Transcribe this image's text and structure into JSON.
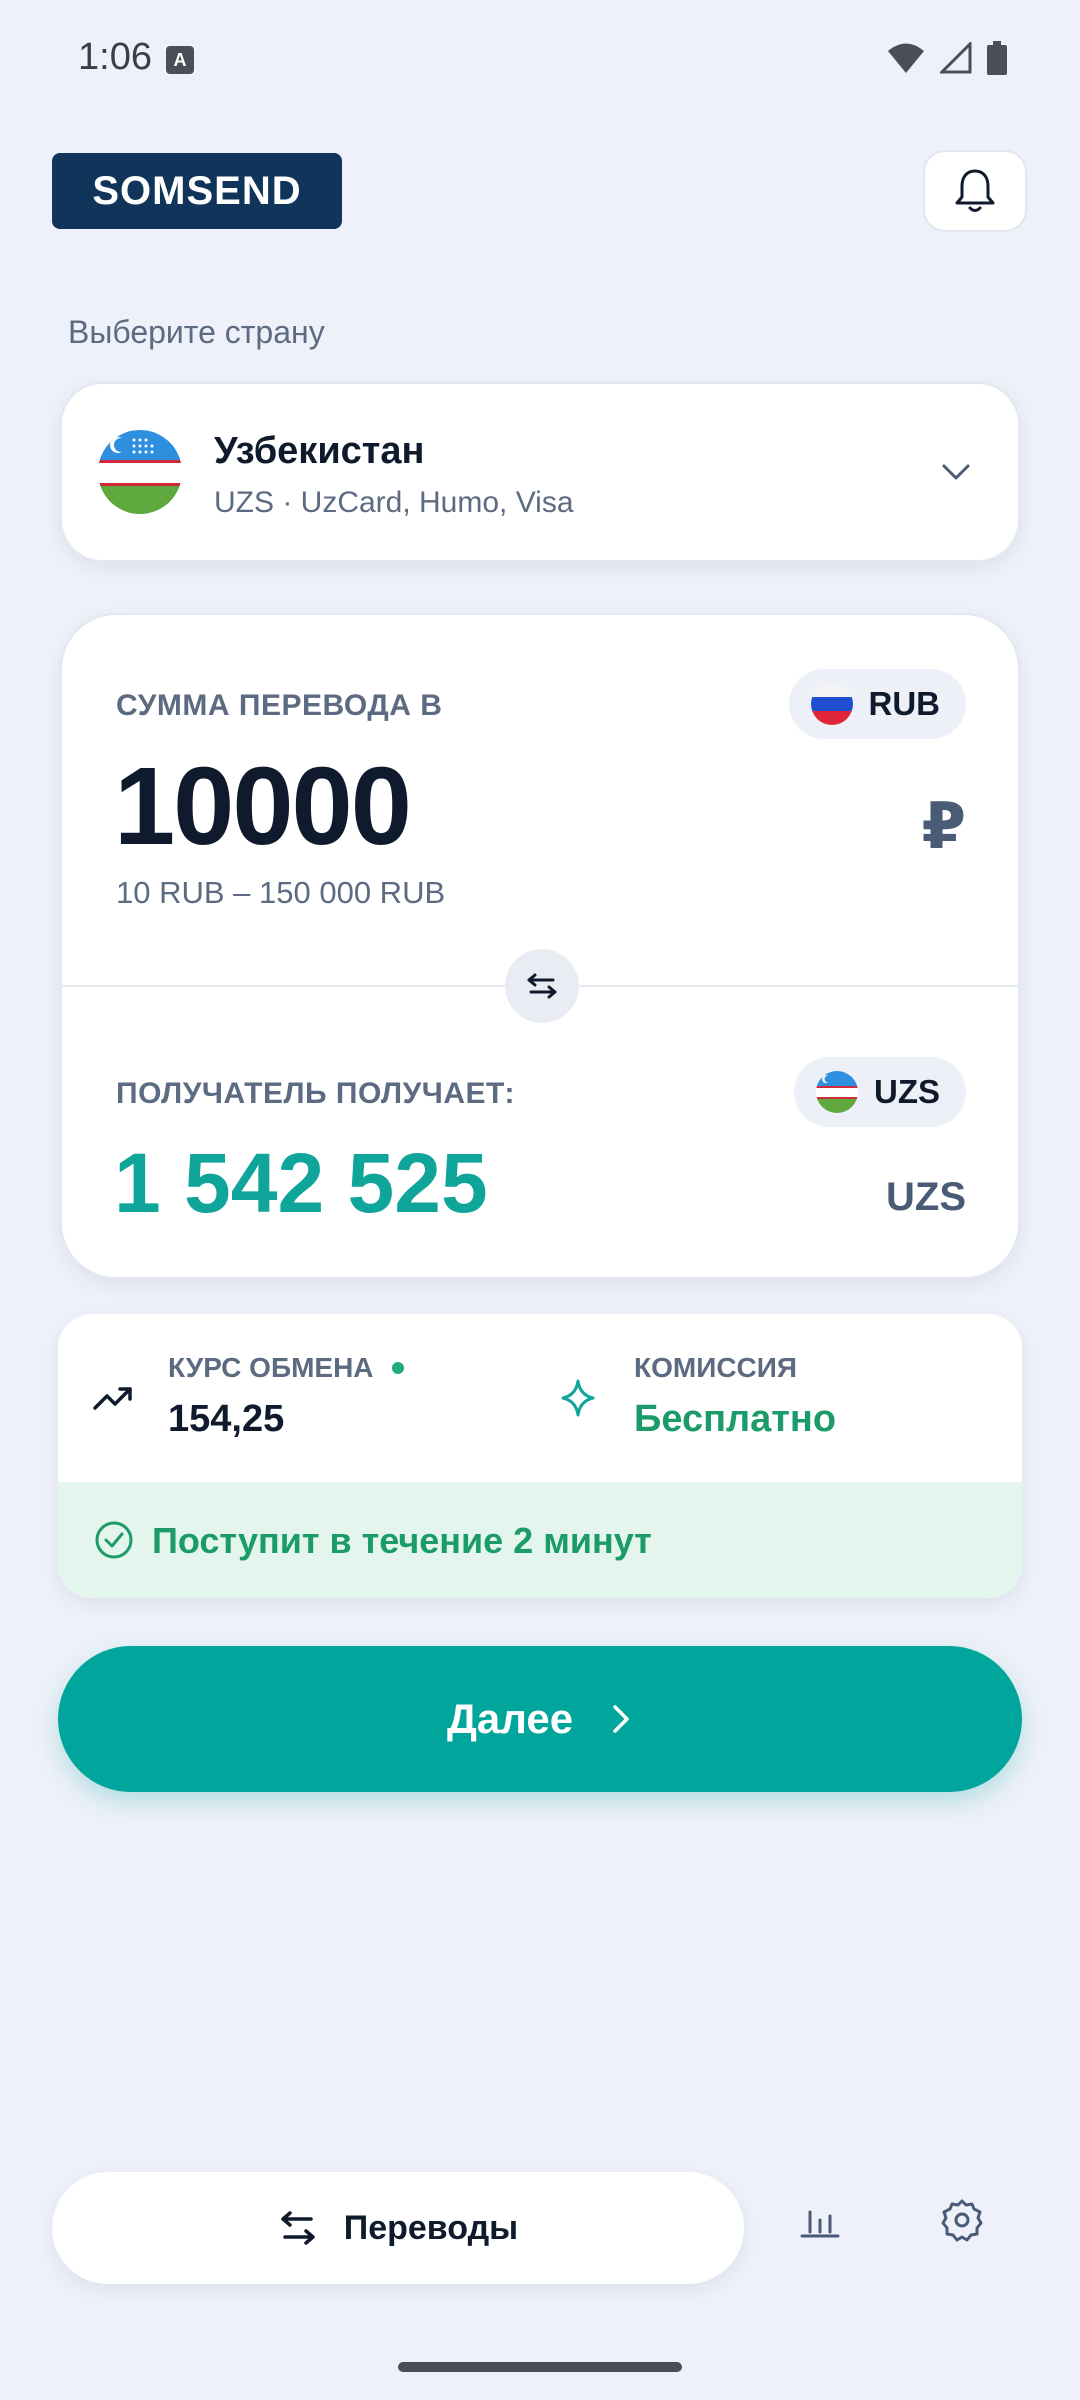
{
  "status_bar": {
    "time": "1:06"
  },
  "header": {
    "logo_text": "SOMSEND"
  },
  "country_section": {
    "label": "Выберите страну",
    "country_name": "Узбекистан",
    "country_details": "UZS · UzCard, Humo, Visa"
  },
  "transfer": {
    "send_label": "СУММА ПЕРЕВОДА В",
    "send_currency": "RUB",
    "send_amount": "10000",
    "send_symbol": "₽",
    "range": "10 RUB – 150 000 RUB",
    "receive_label": "ПОЛУЧАТЕЛЬ ПОЛУЧАЕТ:",
    "receive_currency": "UZS",
    "receive_amount": "1 542 525",
    "receive_symbol": "UZS"
  },
  "info": {
    "rate_label": "КУРС ОБМЕНА",
    "rate_value": "154,25",
    "fee_label": "КОМИССИЯ",
    "fee_value": "Бесплатно",
    "eta_text": "Поступит в течение 2 минут"
  },
  "actions": {
    "next_label": "Далее"
  },
  "bottom_nav": {
    "transfers_label": "Переводы"
  },
  "colors": {
    "accent": "#00a69c",
    "brand": "#10345a",
    "success": "#1c9b6a"
  },
  "icons": [
    "a-icon",
    "wifi-icon",
    "signal-icon",
    "battery-icon",
    "bell-icon",
    "chevron-down-icon",
    "swap-icon",
    "trend-up-icon",
    "sparkle-icon",
    "check-circle-icon",
    "chevron-right-icon",
    "swap-arrows-icon",
    "stats-icon",
    "gear-icon"
  ]
}
